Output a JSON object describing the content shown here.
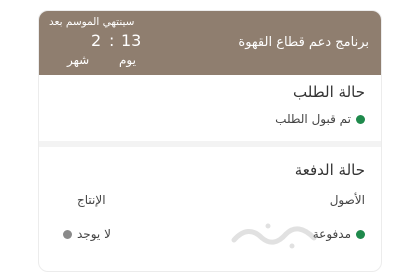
{
  "header": {
    "program_title": "برنامج دعم قطاع القهوة",
    "countdown_label": "سينتهي الموسم بعد",
    "days_value": "13",
    "days_unit": "يوم",
    "separator": ":",
    "months_value": "2",
    "months_unit": "شهر"
  },
  "request": {
    "title": "حالة الطلب",
    "status": "تم قبول الطلب",
    "status_color": "#1f8a4c"
  },
  "payment": {
    "title": "حالة الدفعة",
    "assets_label": "الأصول",
    "assets_status": "مدفوعة",
    "assets_color": "#1f8a4c",
    "production_label": "الإنتاج",
    "production_status": "لا يوجد",
    "production_color": "#8a8a8a"
  },
  "colors": {
    "header_bg": "#8f7e6f"
  }
}
